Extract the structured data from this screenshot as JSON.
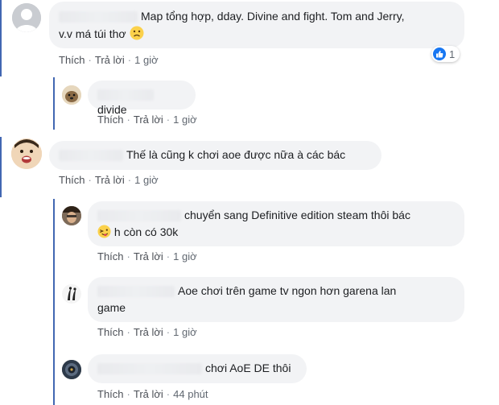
{
  "comments": [
    {
      "text_line1": "Map tổng hợp, dday. Divine and fight. Tom and Jerry,",
      "text_line2": "v.v má túi thơ",
      "actions": {
        "like": "Thích",
        "reply": "Trả lời",
        "time": "1 giờ"
      },
      "reaction_count": "1",
      "replies": [
        {
          "text": "divide",
          "actions": {
            "like": "Thích",
            "reply": "Trả lời",
            "time": "1 giờ"
          }
        }
      ]
    },
    {
      "text": "Thế là cũng k chơi aoe được nữa à các bác",
      "actions": {
        "like": "Thích",
        "reply": "Trả lời",
        "time": "1 giờ"
      },
      "replies": [
        {
          "text_line1": "chuyển sang Definitive edition steam thôi bác",
          "text_line2": "h còn có 30k",
          "actions": {
            "like": "Thích",
            "reply": "Trả lời",
            "time": "1 giờ"
          }
        },
        {
          "text_line1": "Aoe chơi trên game tv ngon hơn garena lan",
          "text_line2": "game",
          "actions": {
            "like": "Thích",
            "reply": "Trả lời",
            "time": "1 giờ"
          }
        },
        {
          "text": "chơi AoE DE thôi",
          "actions": {
            "like": "Thích",
            "reply": "Trả lời",
            "time": "44 phút"
          }
        }
      ]
    }
  ],
  "colors": {
    "bubble": "#f2f3f5",
    "link": "#4b4f56",
    "accent": "#4267b2",
    "like_blue": "#1877f2"
  },
  "icons": {
    "sad_emoji": "sad-face-icon",
    "laugh_emoji": "tongue-face-icon",
    "like": "thumbs-up-icon"
  }
}
